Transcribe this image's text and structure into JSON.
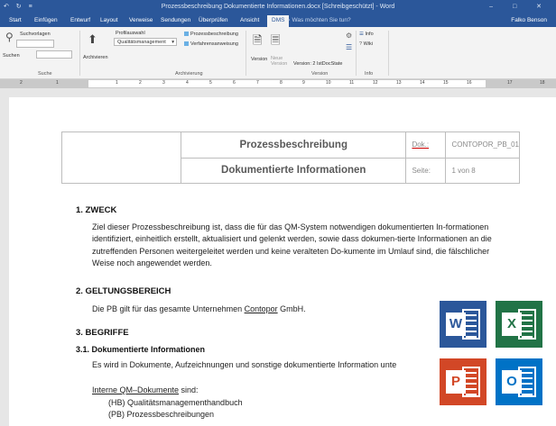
{
  "window": {
    "qat": "↶ ↻ ≡",
    "title": "Prozessbeschreibung Dokumentierte Informationen.docx [Schreibgeschützt] - Word",
    "controls": "– □ ✕"
  },
  "menu": {
    "tabs": [
      "Start",
      "Einfügen",
      "Entwurf",
      "Layout",
      "Verweise",
      "Sendungen",
      "Überprüfen",
      "Ansicht",
      "DMS"
    ],
    "active_tab": "DMS",
    "tellme": "⌕ Was möchten Sie tun?",
    "user": "Falko Benson"
  },
  "ribbon": {
    "suchvorlagen": "Suchvorlagen",
    "suchen": "Suchen",
    "suche_group": "Suche",
    "archivieren": "Archivieren",
    "profilauswahl": "Profilauswahl",
    "profil_value": "Qualitätsmanagement",
    "check1": "Prozessbeschreibung",
    "check2": "Verfahrensanweisung",
    "archivierung_group": "Archivierung",
    "version_btn": "Version",
    "neue_version": "Neue Version",
    "version_info": "Version: 2 IstDocState",
    "version_group": "Version",
    "info": "Info",
    "wiki": "Wiki",
    "info_group": "Info"
  },
  "ruler": {
    "numbers": [
      "2",
      "1",
      "1",
      "2",
      "3",
      "4",
      "5",
      "6",
      "7",
      "8",
      "9",
      "10",
      "11",
      "12",
      "13",
      "14",
      "15",
      "16",
      "17",
      "18"
    ]
  },
  "header": {
    "title1": "Prozessbeschreibung",
    "title2": "Dokumentierte Informationen",
    "key1": "Dok.:",
    "val1": "CONTOPOR_PB_01",
    "key2": "Seite:",
    "val2": "1 von 8"
  },
  "body": {
    "h_zweck": "1. ZWECK",
    "zweck_text": "Ziel dieser Prozessbeschreibung ist, dass die für das QM-System notwendigen dokumentierten In-formationen identifiziert, einheitlich erstellt, aktualisiert und gelenkt werden, sowie dass dokumen-tierte Informationen an die zutreffenden Personen weitergeleitet werden und keine veralteten Do-kumente im Umlauf sind, die fälschlicher Weise noch angewendet werden.",
    "h_geltung": "2. GELTUNGSBEREICH",
    "geltung_pre": "Die PB gilt für das gesamte Unternehmen ",
    "geltung_company": "Contopor",
    "geltung_post": " GmbH.",
    "h_begriffe": "3. BEGRIFFE",
    "h_doc_info": "3.1. Dokumentierte Informationen",
    "doc_info_text": "Es wird in Dokumente, Aufzeichnungen und sonstige dokumentierte Information unte",
    "interne_label": "Interne QM–Dokumente",
    "interne_suffix": " sind:",
    "item1": "(HB) Qualitätsmanagementhandbuch",
    "item2": "(PB) Prozessbeschreibungen"
  },
  "apps": {
    "word": "W",
    "excel": "X",
    "powerpoint": "P",
    "outlook": "O"
  },
  "colors": {
    "word": "#2b579a",
    "excel": "#217346",
    "powerpoint": "#d24726",
    "outlook": "#0072c6"
  }
}
